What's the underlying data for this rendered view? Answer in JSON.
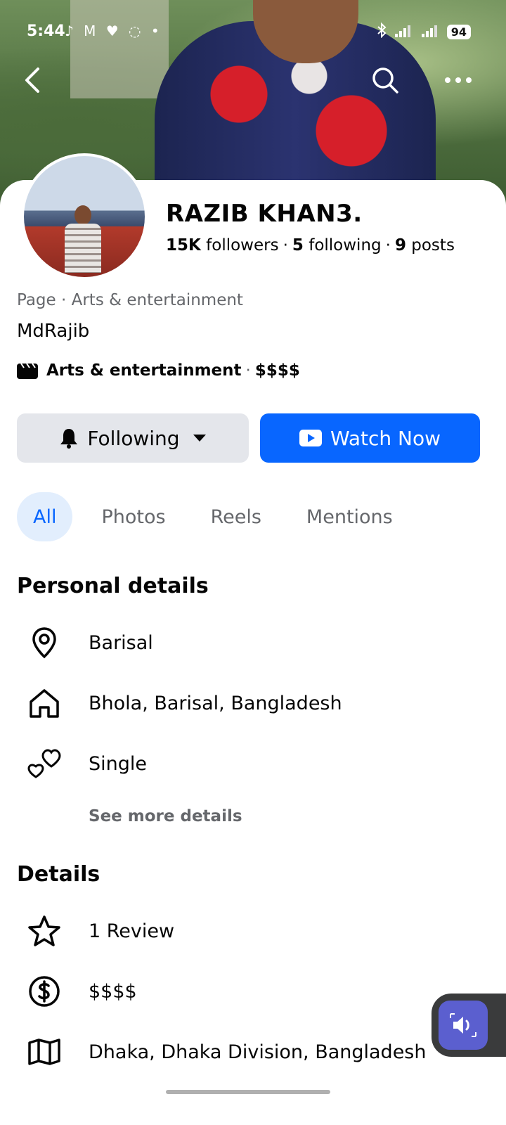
{
  "status_bar": {
    "time": "5:44",
    "notification_icons": "♪ M ♥ ◌ •",
    "battery": "94"
  },
  "profile": {
    "name": "RAZIB KHAN3.",
    "followers_count": "15K",
    "followers_label": "followers",
    "following_count": "5",
    "following_label": "following",
    "posts_count": "9",
    "posts_label": "posts",
    "page_category": "Page · Arts & entertainment",
    "username": "MdRajib",
    "category": "Arts & entertainment",
    "price": "$$$$"
  },
  "actions": {
    "following_label": "Following",
    "watch_label": "Watch Now"
  },
  "tabs": [
    {
      "label": "All"
    },
    {
      "label": "Photos"
    },
    {
      "label": "Reels"
    },
    {
      "label": "Mentions"
    }
  ],
  "personal_details": {
    "title": "Personal details",
    "items": [
      {
        "icon": "location-pin-icon",
        "text": "Barisal"
      },
      {
        "icon": "home-icon",
        "text": "Bhola, Barisal, Bangladesh"
      },
      {
        "icon": "hearts-icon",
        "text": "Single"
      }
    ],
    "see_more": "See more details"
  },
  "details": {
    "title": "Details",
    "items": [
      {
        "icon": "star-icon",
        "text": "1 Review"
      },
      {
        "icon": "dollar-icon",
        "text": "$$$$"
      },
      {
        "icon": "map-icon",
        "text": "Dhaka, Dhaka Division, Bangladesh"
      }
    ]
  },
  "colors": {
    "accent": "#0866ff",
    "active_tab_bg": "#e2eefd",
    "secondary_button": "#e4e6eb",
    "secondary_text": "#65676b"
  }
}
